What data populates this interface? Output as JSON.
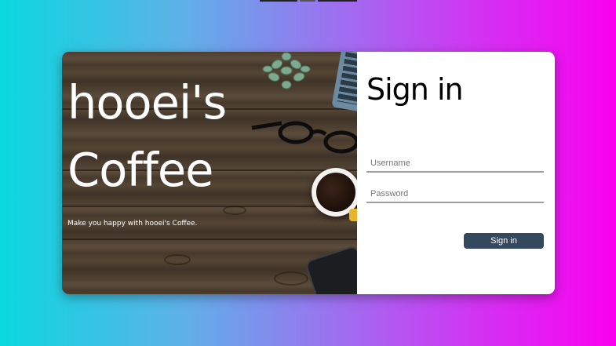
{
  "hero": {
    "title_line1": "hooei's",
    "title_line2": "Coffee",
    "tagline": "Make you happy with hooei's Coffee."
  },
  "signin": {
    "title": "Sign in",
    "username_placeholder": "Username",
    "password_placeholder": "Password",
    "button_label": "Sign in"
  },
  "colors": {
    "background_gradient": [
      "#0bd8df",
      "#9e6ff0",
      "#fb00f0"
    ],
    "button": "#34495e",
    "panel": "#ffffff"
  }
}
